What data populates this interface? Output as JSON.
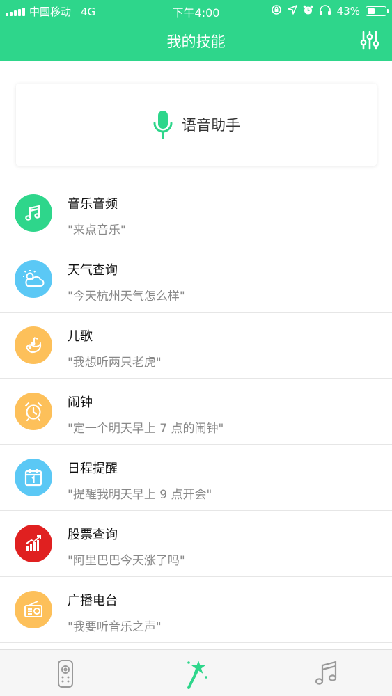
{
  "status_bar": {
    "carrier": "中国移动",
    "network": "4G",
    "time": "下午4:00",
    "battery": "43%",
    "battery_level": 0.43
  },
  "header": {
    "title": "我的技能"
  },
  "voice_card": {
    "label": "语音助手"
  },
  "skills": [
    {
      "title": "音乐音频",
      "example": "\"来点音乐\"",
      "icon": "music-note-icon",
      "color": "#2ed68b"
    },
    {
      "title": "天气查询",
      "example": "\"今天杭州天气怎么样\"",
      "icon": "weather-icon",
      "color": "#5bc8f5"
    },
    {
      "title": "儿歌",
      "example": "\"我想听两只老虎\"",
      "icon": "kids-song-icon",
      "color": "#fdc05a"
    },
    {
      "title": "闹钟",
      "example": "\"定一个明天早上 7 点的闹钟\"",
      "icon": "alarm-clock-icon",
      "color": "#fdc05a"
    },
    {
      "title": "日程提醒",
      "example": "\"提醒我明天早上 9 点开会\"",
      "icon": "calendar-icon",
      "color": "#5bc8f5"
    },
    {
      "title": "股票查询",
      "example": "\"阿里巴巴今天涨了吗\"",
      "icon": "stock-chart-icon",
      "color": "#e02020"
    },
    {
      "title": "广播电台",
      "example": "\"我要听音乐之声\"",
      "icon": "radio-icon",
      "color": "#fdc05a"
    }
  ],
  "colors": {
    "brand": "#2ed68b",
    "tab_active": "#2ed68b",
    "tab_inactive": "#9a9a9a"
  },
  "tabs": [
    {
      "icon": "remote-control-icon",
      "active": false
    },
    {
      "icon": "magic-wand-icon",
      "active": true
    },
    {
      "icon": "music-icon",
      "active": false
    }
  ]
}
